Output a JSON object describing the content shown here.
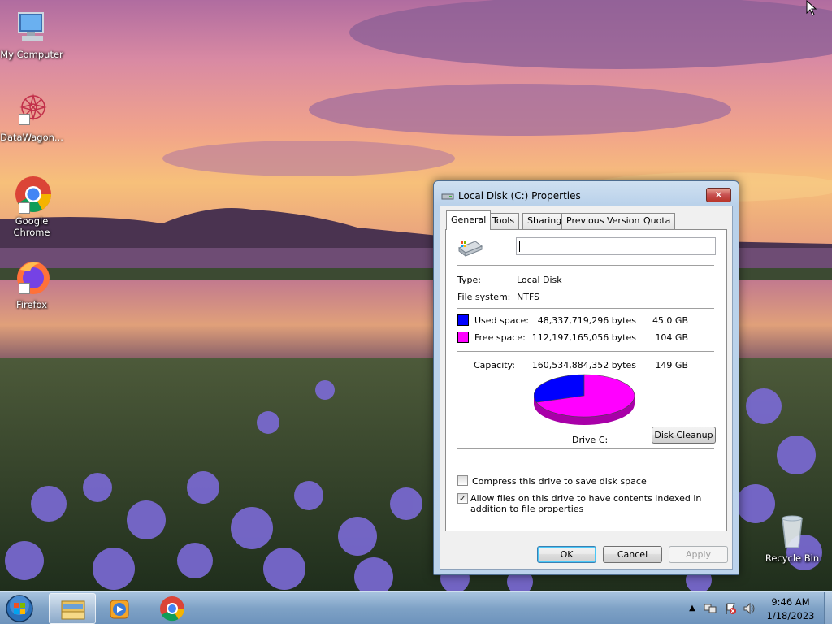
{
  "desktop": {
    "icons": [
      {
        "label": "My Computer"
      },
      {
        "label": "DataWagon..."
      },
      {
        "label": "Google Chrome"
      },
      {
        "label": "Firefox"
      },
      {
        "label": "Recycle Bin"
      }
    ]
  },
  "dialog": {
    "title": "Local Disk (C:) Properties",
    "close_label": "✕",
    "tabs": [
      "General",
      "Tools",
      "Sharing",
      "Previous Versions",
      "Quota"
    ],
    "active_tab": "General",
    "general": {
      "name_value": "",
      "type_label": "Type:",
      "type_value": "Local Disk",
      "fs_label": "File system:",
      "fs_value": "NTFS",
      "used_label": "Used space:",
      "used_bytes": "48,337,719,296 bytes",
      "used_size": "45.0 GB",
      "free_label": "Free space:",
      "free_bytes": "112,197,165,056 bytes",
      "free_size": "104 GB",
      "capacity_label": "Capacity:",
      "capacity_bytes": "160,534,884,352 bytes",
      "capacity_size": "149 GB",
      "drive_label": "Drive C:",
      "disk_cleanup_label": "Disk Cleanup",
      "compress_label": "Compress this drive to save disk space",
      "compress_checked": false,
      "index_label": "Allow files on this drive to have contents indexed in addition to file properties",
      "index_checked": true
    },
    "buttons": {
      "ok": "OK",
      "cancel": "Cancel",
      "apply": "Apply"
    }
  },
  "colors": {
    "used": "#0000ff",
    "free": "#ff00ff"
  },
  "chart_data": {
    "type": "pie",
    "categories": [
      "Used space",
      "Free space"
    ],
    "values": [
      48337719296,
      112197165056
    ]
  },
  "taskbar": {
    "items": [
      "start-orb-icon",
      "windows-explorer-icon",
      "media-player-icon",
      "chrome-icon"
    ],
    "tray": [
      "show-hidden-icons-icon",
      "network-icon",
      "action-center-icon",
      "volume-icon"
    ],
    "time": "9:46 AM",
    "date": "1/18/2023"
  }
}
